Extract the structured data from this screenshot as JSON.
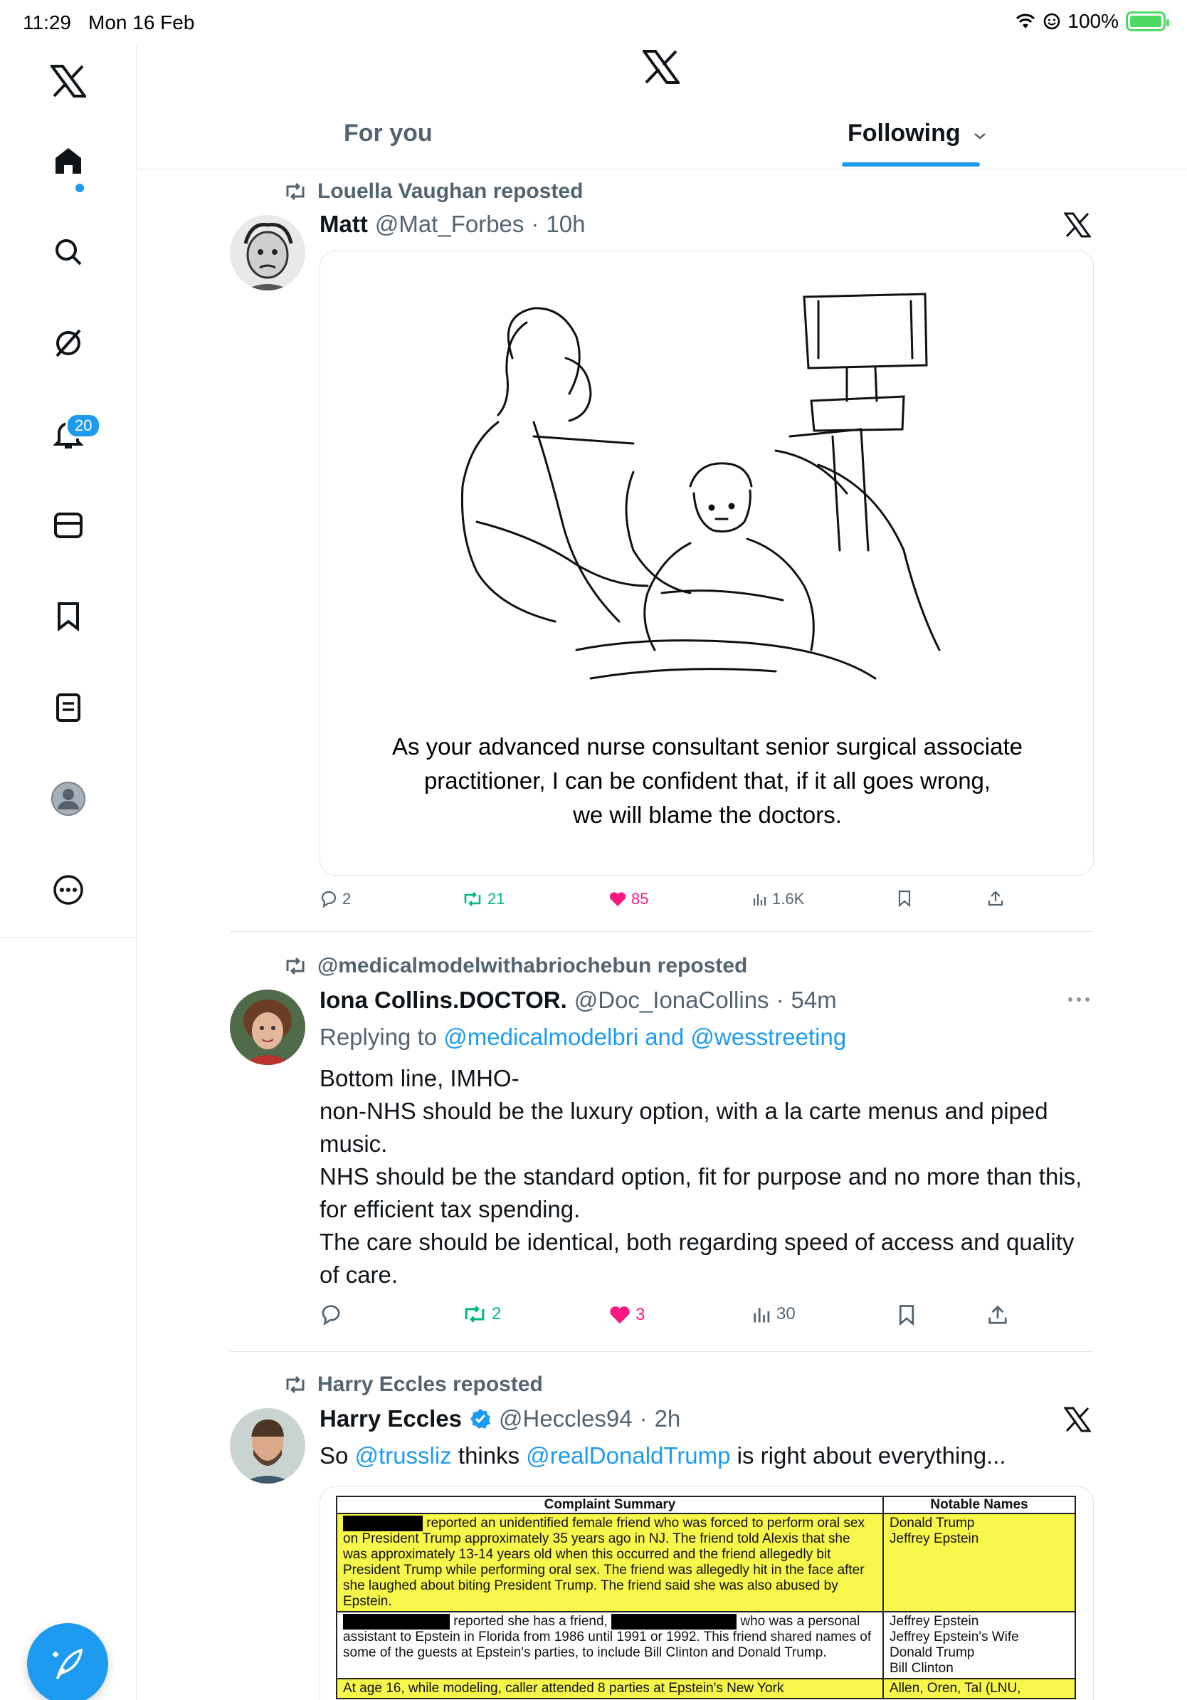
{
  "status_bar": {
    "time": "11:29",
    "date": "Mon 16 Feb",
    "battery": "100%"
  },
  "nav": {
    "notifications_badge": "20"
  },
  "header": {
    "tabs": [
      {
        "label": "For you"
      },
      {
        "label": "Following"
      }
    ]
  },
  "posts": [
    {
      "repost_by": "Louella Vaughan reposted",
      "name": "Matt",
      "handle": "@Mat_Forbes",
      "time": "10h",
      "caption_lines": [
        "As your advanced nurse consultant senior surgical associate",
        "practitioner, I can be confident that, if it all goes wrong,",
        "we will blame the doctors."
      ],
      "stats": {
        "replies": "2",
        "reposts": "21",
        "likes": "85",
        "views": "1.6K"
      }
    },
    {
      "repost_by": "@medicalmodelwithabriochebun reposted",
      "name": "Iona Collins.DOCTOR.",
      "handle": "@Doc_IonaCollins",
      "time": "54m",
      "replying_prefix": "Replying to ",
      "replying_to": "@medicalmodelbri and @wesstreeting",
      "text_lines": [
        "Bottom line, IMHO-",
        "non-NHS should be the luxury option, with a la carte menus and piped music.",
        "NHS should be the standard option, fit for purpose and no more than this, for efficient tax spending.",
        "The care should be identical, both regarding speed of access and quality of care."
      ],
      "stats": {
        "replies": "",
        "reposts": "2",
        "likes": "3",
        "views": "30"
      }
    },
    {
      "repost_by": "Harry Eccles reposted",
      "name": "Harry Eccles",
      "handle": "@Heccles94",
      "time": "2h",
      "text_prefix": "So ",
      "mention1": "@trussliz",
      "text_mid": " thinks ",
      "mention2": "@realDonaldTrump",
      "text_suffix": " is right about everything...",
      "doc_table": {
        "headers": [
          "Complaint Summary",
          "Notable Names"
        ],
        "rows": [
          {
            "summary": "reported an unidentified female friend who was forced to perform oral sex on President Trump approximately 35 years ago in NJ. The friend told Alexis that she was approximately 13-14 years old when this occurred and the friend allegedly bit President Trump while performing oral sex. The friend was allegedly hit in the face after she laughed about biting President Trump. The friend said she was also abused by Epstein.",
            "names": "Donald Trump\nJeffrey Epstein"
          },
          {
            "summary_a": "reported she has a friend,",
            "summary_b": "who was a personal assistant to Epstein in Florida from 1986 until 1991 or 1992. This friend shared names of some of the guests at Epstein's parties, to include Bill Clinton and Donald Trump.",
            "names": "Jeffrey Epstein\nJeffrey Epstein's Wife\nDonald Trump\nBill Clinton"
          },
          {
            "summary": "At age 16, while modeling, caller attended 8 parties at Epstein's New York",
            "names": "Allen, Oren, Tal (LNU,"
          }
        ]
      }
    }
  ],
  "colors": {
    "accent": "#1d9bf0",
    "repost_green": "#00ba7c",
    "like_pink": "#f91880",
    "highlight": "#f7f64a"
  }
}
